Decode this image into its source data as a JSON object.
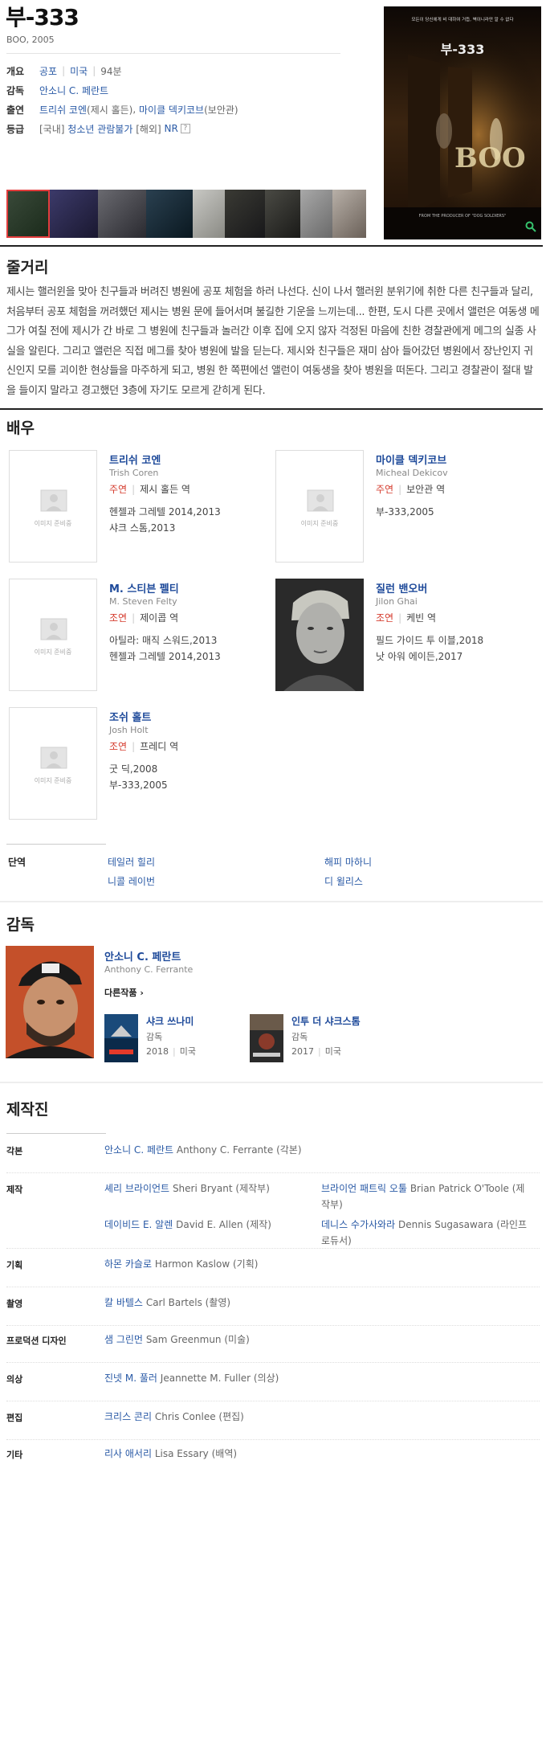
{
  "movie": {
    "title": "부-333",
    "subtitle": "BOO, 2005"
  },
  "info": {
    "genre_label": "개요",
    "genre": "공포",
    "country": "미국",
    "runtime": "94분",
    "director_label": "감독",
    "director": "안소니 C. 페란트",
    "cast_label": "출연",
    "cast_1": "트리쉬 코엔",
    "cast_1_role": "(제시 홀든)",
    "cast_2": "마이클 덱키코브",
    "cast_2_role": "(보안관)",
    "rating_label": "등급",
    "rating_kr_prefix": "[국내]",
    "rating_kr": "청소년 관람불가",
    "rating_intl_prefix": "[해외]",
    "rating_intl": "NR",
    "help": "?"
  },
  "poster": {
    "tagline": "모든이 당신에게 비 대하여 거듭, 벽이니라만 알 수 없다",
    "title_kr": "부-333",
    "title_en": "BOO",
    "credits": "FROM THE PRODUCER OF \"DOG SOLDIERS\""
  },
  "synopsis": {
    "heading": "줄거리",
    "text": "제시는 핼러윈을 맞아 친구들과 버려진 병원에 공포 체험을 하러 나선다. 신이 나서 핼러윈 분위기에 취한 다른 친구들과 달리, 처음부터 공포 체험을 꺼려했던 제시는 병원 문에 들어서며 불길한 기운을 느끼는데... 한편, 도시 다른 곳에서 앨런은 여동생 메그가 여칠 전에 제시가 간 바로 그 병원에 친구들과 놀러간 이후 집에 오지 않자 걱정된 마음에 친한 경찰관에게 메그의 실종 사실을 알린다. 그리고 앨런은 직접 메그를 찾아 병원에 발을 딛는다. 제시와 친구들은 재미 삼아 들어갔던 병원에서 장난인지 귀신인지 모를 괴이한 현상들을 마주하게 되고, 병원 한 쪽편에선 앨런이 여동생을 찾아 병원을 떠돈다. 그리고 경찰관이 절대 발을 들이지 말라고 경고했던 3층에 자기도 모르게 갇히게 된다."
  },
  "cast": {
    "heading": "배우",
    "placeholder": "이미지 준비중",
    "actors": [
      {
        "name": "트리쉬 코엔",
        "name_en": "Trish Coren",
        "type": "주연",
        "role": "제시 홀든 역",
        "works": [
          "헨젤과 그레텔 2014,2013",
          "샤크 스톰,2013"
        ]
      },
      {
        "name": "마이클 덱키코브",
        "name_en": "Micheal Dekicov",
        "type": "주연",
        "role": "보안관 역",
        "works": [
          "부-333,2005"
        ]
      },
      {
        "name": "M. 스티븐 펠티",
        "name_en": "M. Steven Felty",
        "type": "조연",
        "role": "제이콥 역",
        "works": [
          "아틸라: 매직 스워드,2013",
          "헨젤과 그레텔 2014,2013"
        ]
      },
      {
        "name": "질런 밴오버",
        "name_en": "Jilon Ghai",
        "type": "조연",
        "role": "케빈 역",
        "works": [
          "필드 가이드 투 이블,2018",
          "낫 아워 에이든,2017"
        ]
      },
      {
        "name": "조쉬 홀트",
        "name_en": "Josh Holt",
        "type": "조연",
        "role": "프레디 역",
        "works": [
          "굿 딕,2008",
          "부-333,2005"
        ]
      }
    ],
    "cameo_label": "단역",
    "cameos": [
      "테일러 힐리",
      "해피 마하니",
      "니콜 레이번",
      "디 윌리스"
    ]
  },
  "director": {
    "heading": "감독",
    "name": "안소니 C. 페란트",
    "name_en": "Anthony C. Ferrante",
    "other_label": "다른작품",
    "works": [
      {
        "title": "샤크 쓰나미",
        "role": "감독",
        "year": "2018",
        "country": "미국"
      },
      {
        "title": "인투 더 샤크스톰",
        "role": "감독",
        "year": "2017",
        "country": "미국"
      }
    ]
  },
  "crew": {
    "heading": "제작진",
    "rows": [
      {
        "label": "각본",
        "items": [
          {
            "name": "안소니 C. 페란트",
            "en": "Anthony C. Ferrante",
            "role": "(각본)"
          }
        ]
      },
      {
        "label": "제작",
        "items": [
          {
            "name": "셰리 브라이언트",
            "en": "Sheri Bryant",
            "role": "(제작부)"
          },
          {
            "name": "브라이언 패트릭 오툴",
            "en": "Brian Patrick O'Toole",
            "role": "(제작부)"
          },
          {
            "name": "데이비드 E. 알렌",
            "en": "David E. Allen",
            "role": "(제작)"
          },
          {
            "name": "데니스 수가사와라",
            "en": "Dennis Sugasawara",
            "role": "(라인프로듀서)"
          }
        ]
      },
      {
        "label": "기획",
        "items": [
          {
            "name": "하몬 카슬로",
            "en": "Harmon Kaslow",
            "role": "(기획)"
          }
        ]
      },
      {
        "label": "촬영",
        "items": [
          {
            "name": "칼 바텔스",
            "en": "Carl Bartels",
            "role": "(촬영)"
          }
        ]
      },
      {
        "label": "프로덕션 디자인",
        "items": [
          {
            "name": "샘 그린먼",
            "en": "Sam Greenmun",
            "role": "(미술)"
          }
        ]
      },
      {
        "label": "의상",
        "items": [
          {
            "name": "진넷 M. 풀러",
            "en": "Jeannette M. Fuller",
            "role": "(의상)"
          }
        ]
      },
      {
        "label": "편집",
        "items": [
          {
            "name": "크리스 콘리",
            "en": "Chris Conlee",
            "role": "(편집)"
          }
        ]
      },
      {
        "label": "기타",
        "items": [
          {
            "name": "리사 애서리",
            "en": "Lisa Essary",
            "role": "(배역)"
          }
        ]
      }
    ]
  }
}
